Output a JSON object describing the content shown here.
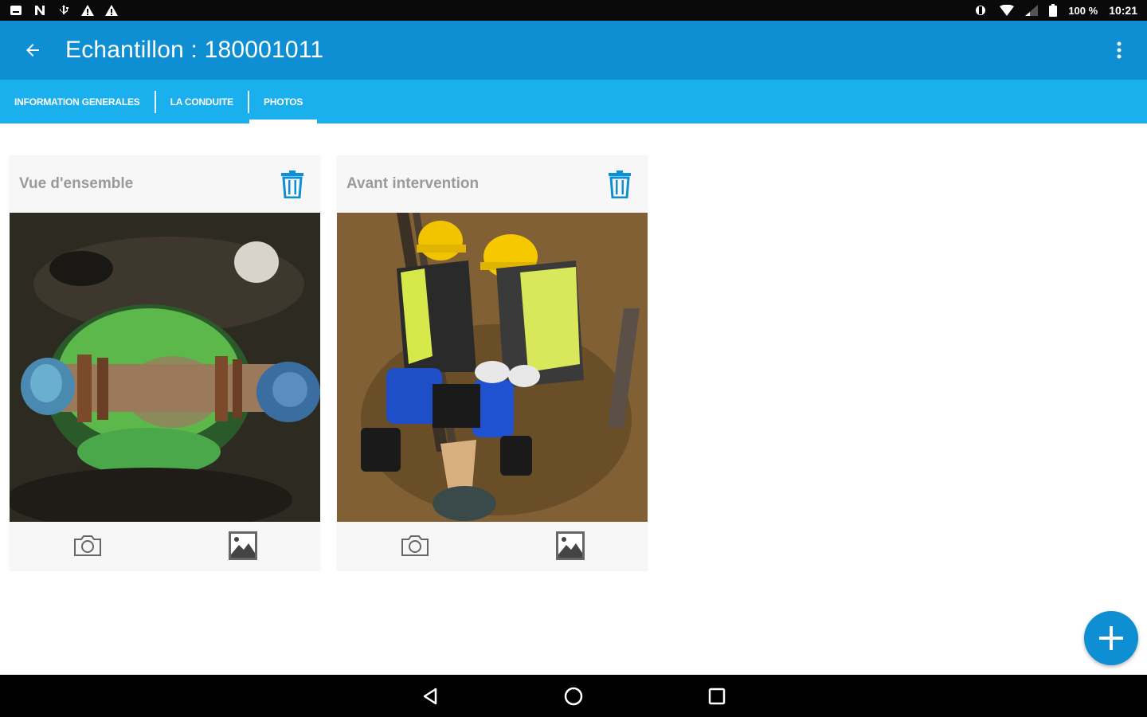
{
  "status_bar": {
    "left_icons": [
      "notification-icon",
      "n-icon",
      "usb-icon",
      "warning-icon",
      "warning-icon"
    ],
    "battery_percent": "100 %",
    "time": "10:21"
  },
  "app_bar": {
    "title": "Echantillon : 180001011",
    "back_icon": "arrow-back-icon",
    "menu_icon": "more-vert-icon"
  },
  "tabs": [
    {
      "label": "INFORMATION GENERALES",
      "active": false
    },
    {
      "label": "LA CONDUITE",
      "active": false
    },
    {
      "label": "PHOTOS",
      "active": true
    }
  ],
  "cards": [
    {
      "title": "Vue d'ensemble",
      "photo": "valve-pipe-photo",
      "delete_icon": "trash-icon",
      "camera_icon": "camera-icon",
      "gallery_icon": "gallery-icon"
    },
    {
      "title": "Avant intervention",
      "photo": "workers-trench-photo",
      "delete_icon": "trash-icon",
      "camera_icon": "camera-icon",
      "gallery_icon": "gallery-icon"
    }
  ],
  "fab": {
    "icon": "plus-icon"
  },
  "nav_bar": {
    "icons": [
      "back-triangle-icon",
      "home-circle-icon",
      "recents-square-icon"
    ]
  },
  "colors": {
    "primary": "#0e8fd4",
    "tab_bar": "#1ab0ee",
    "card_bg": "#f7f7f7",
    "card_title": "#9a9a9a"
  }
}
